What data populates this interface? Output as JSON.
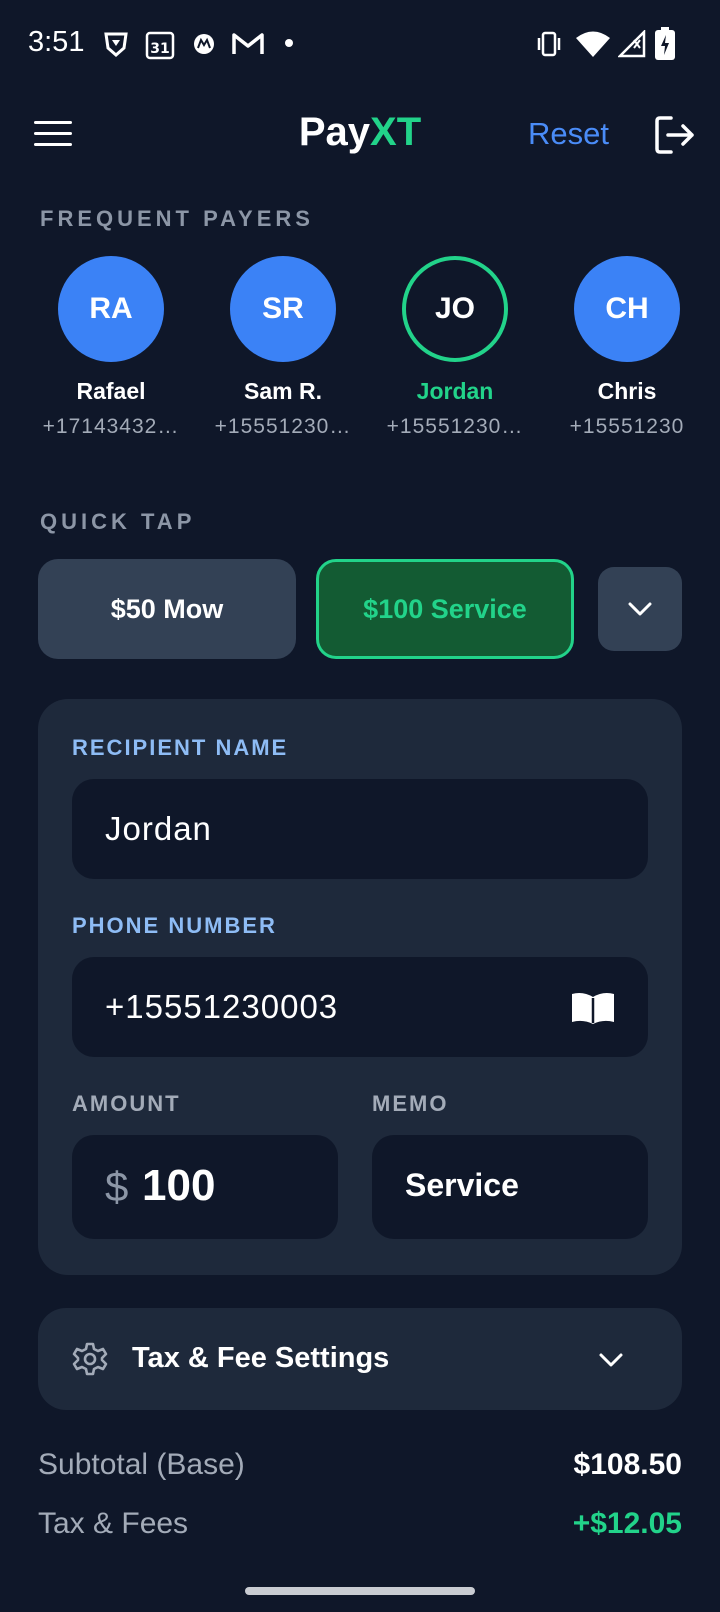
{
  "status_bar": {
    "time": "3:51"
  },
  "app_bar": {
    "title_part1": "Pay",
    "title_part2": "XT",
    "reset_label": "Reset"
  },
  "frequent_payers": {
    "label": "FREQUENT PAYERS",
    "items": [
      {
        "initials": "RA",
        "name": "Rafael",
        "phone": "+17143432…"
      },
      {
        "initials": "SR",
        "name": "Sam R.",
        "phone": "+15551230…"
      },
      {
        "initials": "JO",
        "name": "Jordan",
        "phone": "+15551230…"
      },
      {
        "initials": "CH",
        "name": "Chris",
        "phone": "+15551230"
      }
    ]
  },
  "quick_tap": {
    "label": "QUICK TAP",
    "buttons": [
      {
        "label": "$50 Mow"
      },
      {
        "label": "$100 Service"
      }
    ]
  },
  "form": {
    "recipient_label": "RECIPIENT NAME",
    "recipient_value": "Jordan",
    "phone_label": "PHONE NUMBER",
    "phone_value": "+15551230003",
    "amount_label": "AMOUNT",
    "currency_symbol": "$",
    "amount_value": "100",
    "memo_label": "MEMO",
    "memo_value": "Service"
  },
  "settings": {
    "label": "Tax & Fee Settings"
  },
  "summary": {
    "subtotal_label": "Subtotal (Base)",
    "subtotal_value": "$108.50",
    "tax_label": "Tax & Fees",
    "tax_value": "+$12.05"
  },
  "colors": {
    "accent_green": "#22d38a",
    "accent_blue": "#3b82f6",
    "background": "#0f1729",
    "card": "#1e293b"
  }
}
